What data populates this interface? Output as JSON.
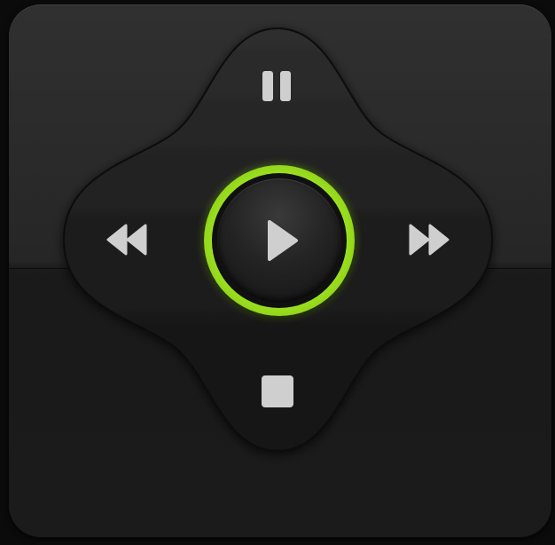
{
  "controls": {
    "pause_icon": "pause-icon",
    "stop_icon": "stop-icon",
    "rewind_icon": "rewind-icon",
    "forward_icon": "fast-forward-icon",
    "play_icon": "play-icon"
  },
  "colors": {
    "background": "#0b0b0b",
    "panel": "#2a2a2a",
    "dpad": "#1a1a1a",
    "icon": "#d0d0d0",
    "accent_ring": "#9fe320"
  }
}
